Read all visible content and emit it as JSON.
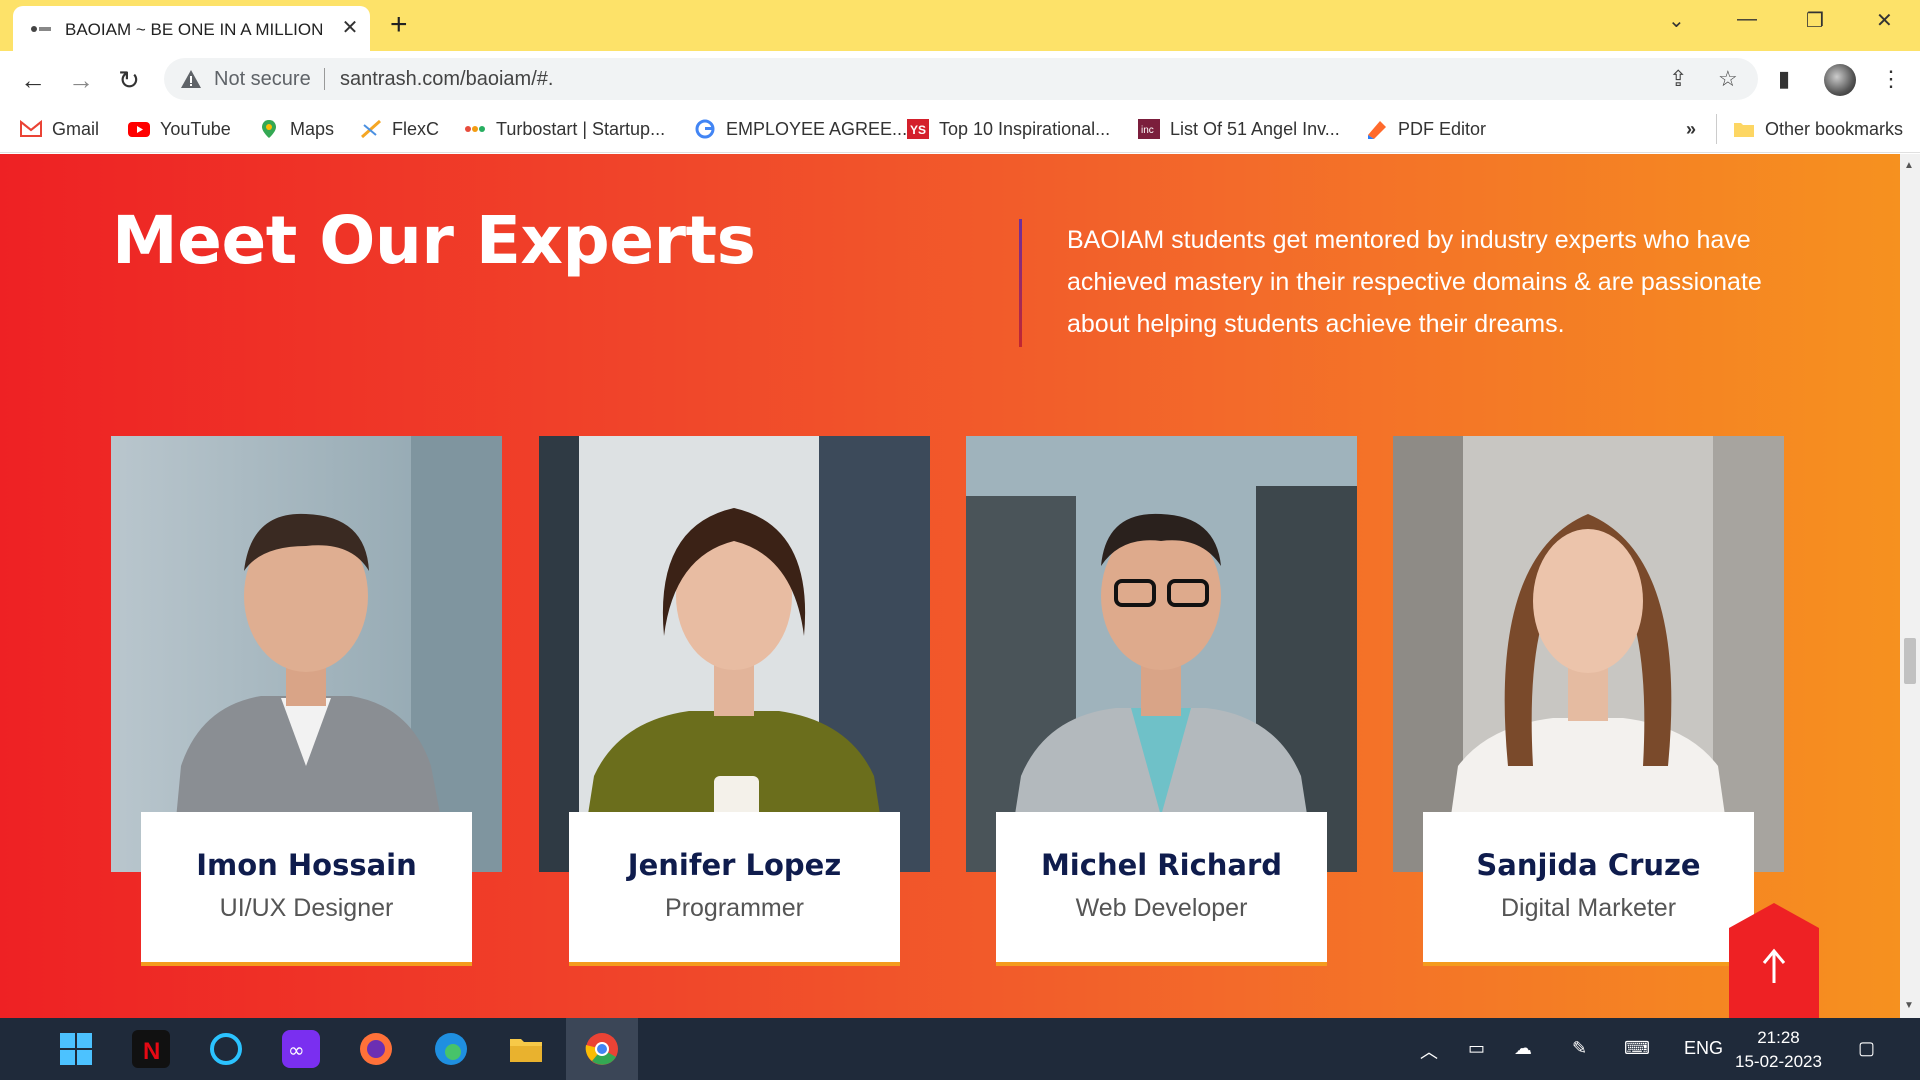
{
  "browser": {
    "tab_title": "BAOIAM ~ BE ONE IN A MILLION",
    "address": {
      "security_label": "Not secure",
      "url": "santrash.com/baoiam/#."
    },
    "bookmarks": [
      {
        "label": "Gmail",
        "icon": "gmail-icon"
      },
      {
        "label": "YouTube",
        "icon": "youtube-icon"
      },
      {
        "label": "Maps",
        "icon": "maps-icon"
      },
      {
        "label": "FlexC",
        "icon": "flexc-icon"
      },
      {
        "label": "Turbostart | Startup...",
        "icon": "turbostart-icon"
      },
      {
        "label": "EMPLOYEE AGREE...",
        "icon": "google-icon"
      },
      {
        "label": "Top 10 Inspirational...",
        "icon": "yourstory-icon"
      },
      {
        "label": "List Of 51 Angel Inv...",
        "icon": "inc42-icon"
      },
      {
        "label": "PDF Editor",
        "icon": "pdf-editor-icon"
      }
    ],
    "bookmarks_overflow": "»",
    "other_bookmarks": "Other bookmarks"
  },
  "section": {
    "heading": "Meet Our Experts",
    "description": "BAOIAM students get mentored by industry experts who have achieved mastery in their respective domains & are passionate about helping students achieve their dreams.",
    "experts": [
      {
        "name": "Imon Hossain",
        "role": "UI/UX Designer"
      },
      {
        "name": "Jenifer Lopez",
        "role": "Programmer"
      },
      {
        "name": "Michel Richard",
        "role": "Web Developer"
      },
      {
        "name": "Sanjida Cruze",
        "role": "Digital Marketer"
      }
    ]
  },
  "taskbar": {
    "language": "ENG",
    "time": "21:28",
    "date": "15-02-2023"
  },
  "colors": {
    "gradient_start": "#ee2124",
    "gradient_end": "#f6911f",
    "name_color": "#0f1c4d",
    "tabstrip": "#fde269"
  }
}
